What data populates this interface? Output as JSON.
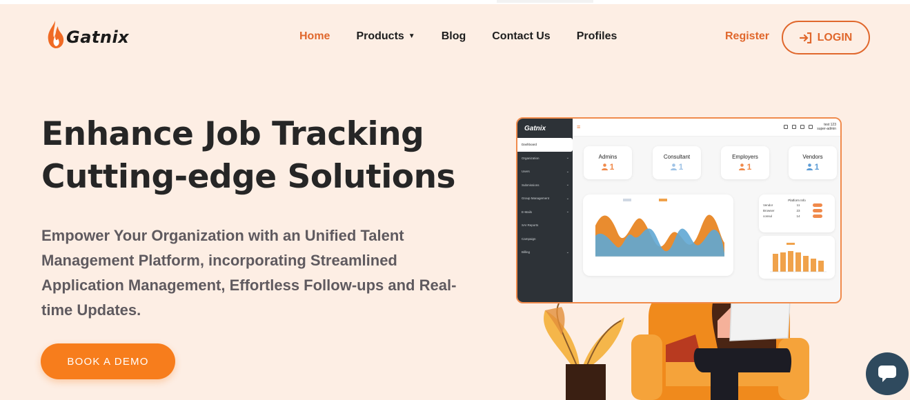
{
  "brand": {
    "name": "Gatnix",
    "accent": "#e0672c",
    "button_color": "#f77d1c",
    "bg": "#fdeee4"
  },
  "nav": {
    "items": [
      {
        "label": "Home",
        "active": true
      },
      {
        "label": "Products",
        "dropdown": true
      },
      {
        "label": "Blog"
      },
      {
        "label": "Contact Us"
      },
      {
        "label": "Profiles"
      }
    ],
    "caret_icon": "▼"
  },
  "auth": {
    "register": "Register",
    "login": "LOGIN",
    "login_icon": "sign-in-icon"
  },
  "hero": {
    "title_line1": "Enhance Job Tracking",
    "title_line2": "Cutting-edge Solutions",
    "subtitle": "Empower Your Organization with an Unified Talent Management Platform, incorporating Streamlined Application Management, Effortless Follow-ups and Real-time Updates.",
    "cta": "BOOK A DEMO"
  },
  "mockup": {
    "logo": "Gatnix",
    "user_name": "test 123",
    "user_role": "super-admin",
    "sidebar": [
      {
        "label": "Dashboard",
        "active": true
      },
      {
        "label": "Organization",
        "chevron": true
      },
      {
        "label": "Users",
        "chevron": true
      },
      {
        "label": "Submissions",
        "chevron": true
      },
      {
        "label": "Group Management",
        "chevron": true
      },
      {
        "label": "E-Mails",
        "chevron": true
      },
      {
        "label": "SAI Reports"
      },
      {
        "label": "Campaign"
      },
      {
        "label": "Billing",
        "chevron": true
      }
    ],
    "cards": [
      {
        "label": "Admins",
        "value": "1",
        "color": "#f08a4b"
      },
      {
        "label": "Consultant",
        "value": "1",
        "color": "#9fc3e6"
      },
      {
        "label": "Employers",
        "value": "1",
        "color": "#f08a4b"
      },
      {
        "label": "Vendors",
        "value": "1",
        "color": "#5b9bd5"
      }
    ],
    "platform_info": {
      "title": "Platform Info",
      "rows": [
        {
          "name": "Vendor",
          "value": "11"
        },
        {
          "name": "Browser",
          "value": "23"
        },
        {
          "name": "consul",
          "value": "14"
        }
      ]
    }
  },
  "chat": {
    "icon": "chat-bubble-icon"
  }
}
